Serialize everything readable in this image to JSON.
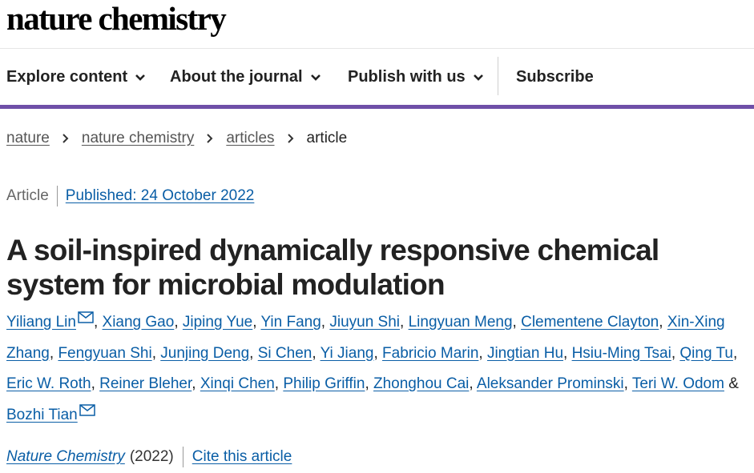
{
  "masthead": {
    "logo": "nature chemistry"
  },
  "nav": {
    "items": [
      {
        "label": "Explore content",
        "dropdown": true
      },
      {
        "label": "About the journal",
        "dropdown": true
      },
      {
        "label": "Publish with us",
        "dropdown": true
      },
      {
        "label": "Subscribe",
        "dropdown": false
      }
    ],
    "accent_color": "#6f4fa8"
  },
  "breadcrumb": [
    "nature",
    "nature chemistry",
    "articles",
    "article"
  ],
  "article": {
    "type": "Article",
    "published": "Published: 24 October 2022",
    "title": "A soil-inspired dynamically responsive chemical system for microbial modulation",
    "authors": [
      "Yiliang Lin",
      "Xiang Gao",
      "Jiping Yue",
      "Yin Fang",
      "Jiuyun Shi",
      "Lingyuan Meng",
      "Clementene Clayton",
      "Xin-Xing Zhang",
      "Fengyuan Shi",
      "Junjing Deng",
      "Si Chen",
      "Yi Jiang",
      "Fabricio Marin",
      "Jingtian Hu",
      "Hsiu-Ming Tsai",
      "Qing Tu",
      "Eric W. Roth",
      "Reiner Bleher",
      "Xinqi Chen",
      "Philip Griffin",
      "Zhonghou Cai",
      "Aleksander Prominski",
      "Teri W. Odom",
      "Bozhi Tian"
    ],
    "corresponding_authors": [
      "Yiliang Lin",
      "Bozhi Tian"
    ],
    "journal": "Nature Chemistry",
    "year": "(2022)",
    "cite_label": "Cite this article"
  },
  "colors": {
    "link": "#0a5ea6",
    "text": "#222222"
  }
}
